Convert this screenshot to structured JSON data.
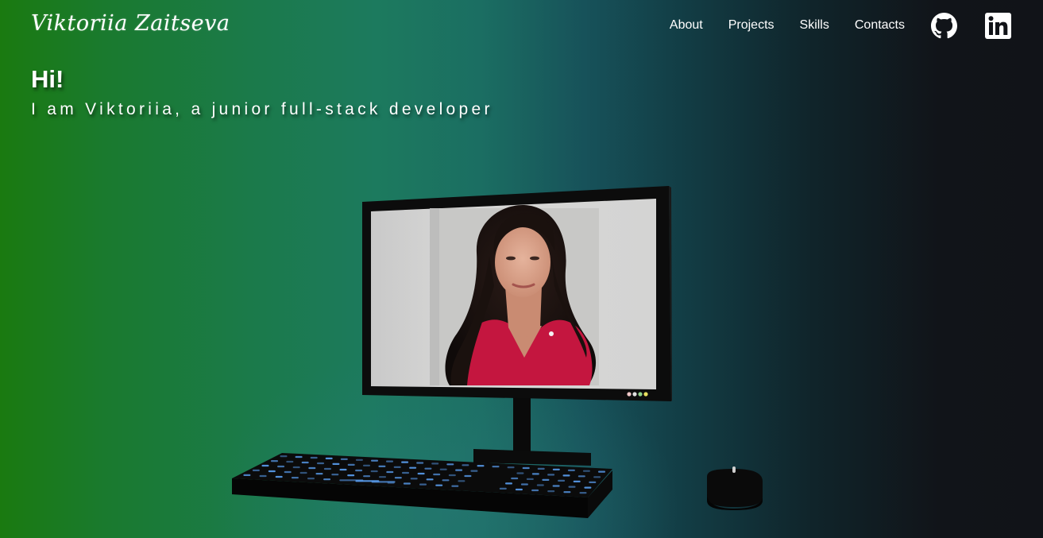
{
  "header": {
    "logo_text": "Viktoriia Zaitseva",
    "nav": {
      "about": "About",
      "projects": "Projects",
      "skills": "Skills",
      "contacts": "Contacts"
    },
    "icons": {
      "github": "github-icon",
      "linkedin": "linkedin-icon"
    }
  },
  "hero": {
    "greeting": "Hi!",
    "subtitle": "I am Viktoriia, a junior full-stack developer"
  },
  "scene": {
    "objects": [
      "monitor",
      "keyboard",
      "mouse"
    ],
    "screen_content": "portrait photo"
  },
  "colors": {
    "gradient_left": "#1a7a10",
    "gradient_mid": "#1c7a5e",
    "gradient_right": "#111318",
    "text": "#ffffff",
    "key_glow": "#5fa8ff",
    "shirt": "#c4163f"
  }
}
